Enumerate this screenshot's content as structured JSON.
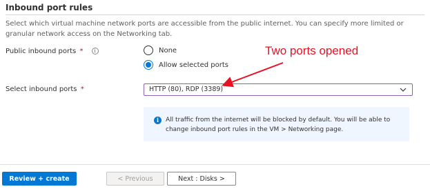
{
  "section": {
    "title": "Inbound port rules",
    "description": "Select which virtual machine network ports are accessible from the public internet. You can specify more limited or granular network access on the Networking tab."
  },
  "public_inbound": {
    "label": "Public inbound ports",
    "required_mark": "*",
    "info_glyph": "i",
    "options": [
      {
        "label": "None",
        "selected": false
      },
      {
        "label": "Allow selected ports",
        "selected": true
      }
    ]
  },
  "select_inbound": {
    "label": "Select inbound ports",
    "required_mark": "*",
    "value": "HTTP (80), RDP (3389)"
  },
  "info_box": {
    "icon": "info-icon",
    "glyph": "i",
    "text": "All traffic from the internet will be blocked by default. You will be able to change inbound port rules in the VM > Networking page."
  },
  "annotation": {
    "text": "Two ports opened",
    "color": "#e81123"
  },
  "footer": {
    "review_label": "Review + create",
    "previous_label": "< Previous",
    "next_label": "Next : Disks >"
  },
  "colors": {
    "accent": "#0078d4",
    "focus_border": "#8764b8",
    "required": "#a4262c",
    "info_bg": "#f0f6ff"
  }
}
